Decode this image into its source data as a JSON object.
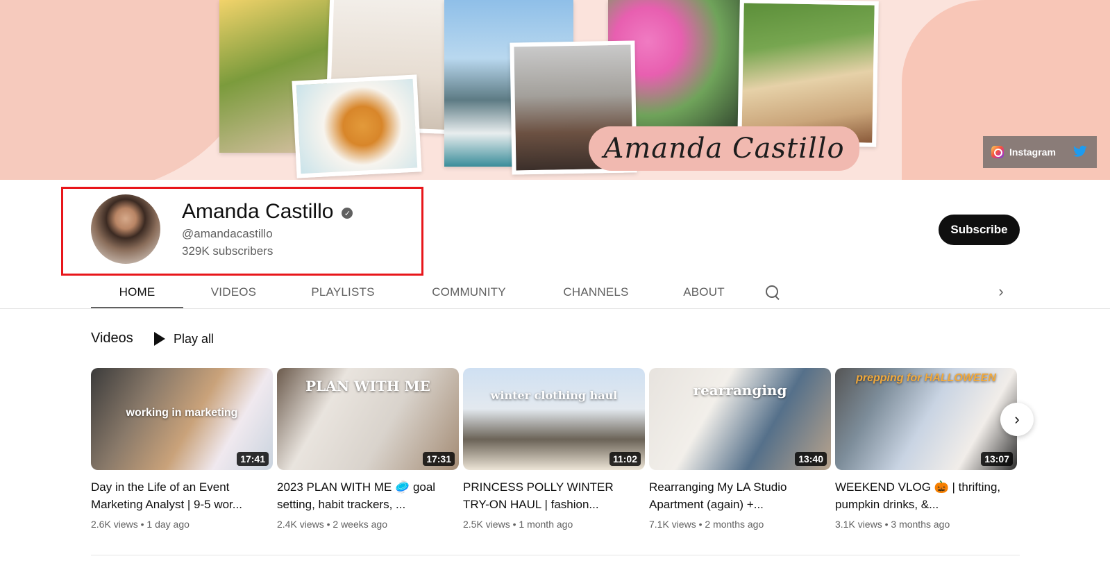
{
  "banner": {
    "signature": "Amanda Castillo",
    "social": {
      "instagram_label": "Instagram"
    }
  },
  "channel": {
    "name": "Amanda Castillo",
    "handle": "@amandacastillo",
    "subscribers": "329K subscribers",
    "subscribe_label": "Subscribe"
  },
  "tabs": [
    {
      "label": "HOME",
      "active": true
    },
    {
      "label": "VIDEOS"
    },
    {
      "label": "PLAYLISTS"
    },
    {
      "label": "COMMUNITY"
    },
    {
      "label": "CHANNELS"
    },
    {
      "label": "ABOUT"
    }
  ],
  "shelf": {
    "title": "Videos",
    "play_all": "Play all"
  },
  "videos": [
    {
      "title": "Day in the Life of an Event Marketing Analyst | 9-5 wor...",
      "views": "2.6K views",
      "age": "1 day ago",
      "duration": "17:41",
      "overlay": "working in marketing"
    },
    {
      "title": "2023 PLAN WITH ME 🥏 goal setting, habit trackers, ...",
      "views": "2.4K views",
      "age": "2 weeks ago",
      "duration": "17:31",
      "overlay": "PLAN WITH ME"
    },
    {
      "title": "PRINCESS POLLY WINTER TRY-ON HAUL | fashion...",
      "views": "2.5K views",
      "age": "1 month ago",
      "duration": "11:02",
      "overlay": "winter clothing haul"
    },
    {
      "title": "Rearranging My LA Studio Apartment (again) +...",
      "views": "7.1K views",
      "age": "2 months ago",
      "duration": "13:40",
      "overlay": "rearranging"
    },
    {
      "title": "WEEKEND VLOG 🎃 | thrifting, pumpkin drinks, &...",
      "views": "3.1K views",
      "age": "3 months ago",
      "duration": "13:07",
      "overlay": "prepping for HALLOWEEN"
    }
  ],
  "colors": {
    "accent_dark": "#0f0f0f",
    "secondary_text": "#606060",
    "highlight_red": "#e8161b"
  }
}
